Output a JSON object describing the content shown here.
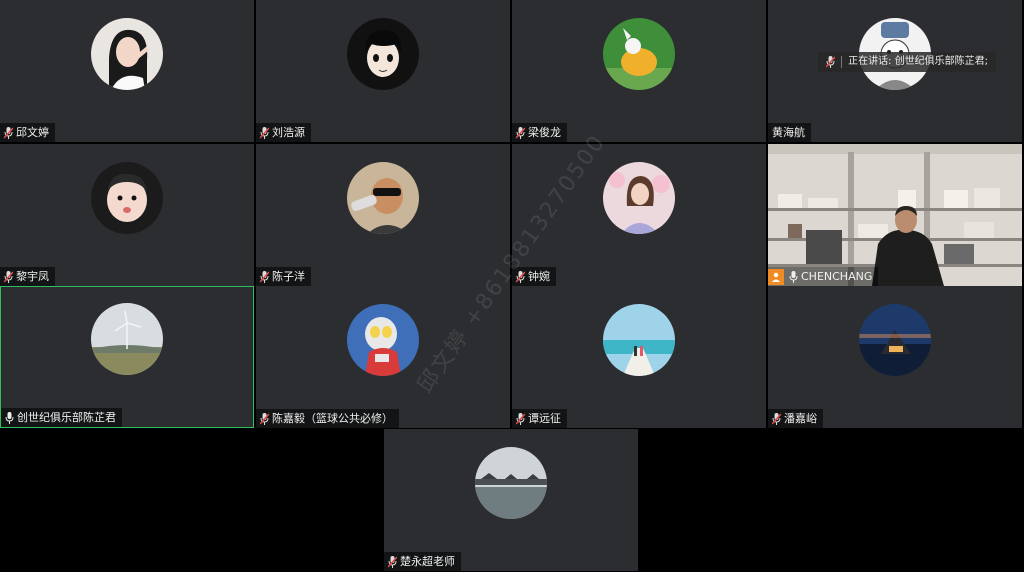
{
  "participants": [
    {
      "name": "邱文婷",
      "mic": "muted",
      "avatar": "girl-portrait"
    },
    {
      "name": "刘浩源",
      "mic": "muted",
      "avatar": "cartoon-boy"
    },
    {
      "name": "梁俊龙",
      "mic": "muted",
      "avatar": "cartoon-animal"
    },
    {
      "name": "黄海航",
      "mic": "none",
      "avatar": "cartoon-hat"
    },
    {
      "name": "黎宇凤",
      "mic": "muted",
      "avatar": "baby-photo"
    },
    {
      "name": "陈子洋",
      "mic": "muted",
      "avatar": "sunglasses-drinking"
    },
    {
      "name": "钟婉",
      "mic": "muted",
      "avatar": "woman-flowers"
    },
    {
      "name": "CHENCHANG",
      "mic": "on",
      "avatar": "camera-video"
    },
    {
      "name": "创世纪俱乐部陈芷君",
      "mic": "on",
      "avatar": "wind-turbine-landscape"
    },
    {
      "name": "陈嘉毅（篮球公共必修）",
      "mic": "muted",
      "avatar": "ultraman-cartoon"
    },
    {
      "name": "谭远征",
      "mic": "muted",
      "avatar": "couple-beach"
    },
    {
      "name": "潘嘉峪",
      "mic": "muted",
      "avatar": "night-cabin"
    },
    {
      "name": "楚永超老师",
      "mic": "muted",
      "avatar": "lake-pavilion"
    }
  ],
  "speaking_indicator": "正在讲话: 创世纪俱乐部陈芷君;",
  "watermark": "邱文婷 +8618813270500",
  "colors": {
    "tile_bg": "#2c2d30",
    "active_border": "#2fbf5e",
    "muted_mic": "#e04b4b",
    "user_icon": "#f08a24"
  }
}
